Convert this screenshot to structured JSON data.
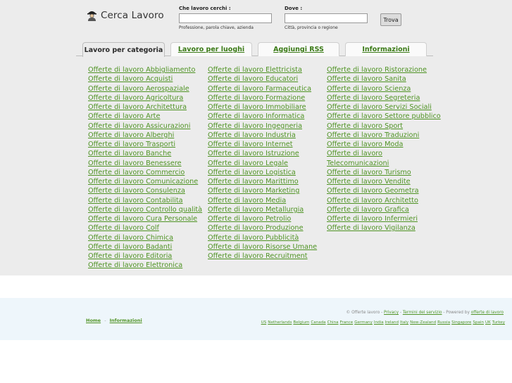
{
  "logo": {
    "text": "Cerca Lavoro"
  },
  "search": {
    "what_label": "Che lavoro cerchi :",
    "what_hint": "Professione, parola chiave, azienda",
    "what_value": "",
    "where_label": "Dove :",
    "where_hint": "Città, provincia o regione",
    "where_value": "",
    "button_label": "Trova"
  },
  "tabs": [
    {
      "label": "Lavoro per categoria",
      "active": true
    },
    {
      "label": "Lavoro per luoghi",
      "active": false
    },
    {
      "label": "Aggiungi RSS",
      "active": false
    },
    {
      "label": "Informazioni",
      "active": false
    }
  ],
  "categories": {
    "col1": [
      "Offerte di lavoro Abbigliamento",
      "Offerte di lavoro Acquisti",
      "Offerte di lavoro Aerospaziale",
      "Offerte di lavoro Agricoltura",
      "Offerte di lavoro Architettura",
      "Offerte di lavoro Arte",
      "Offerte di lavoro Assicurazioni",
      "Offerte di lavoro Alberghi",
      "Offerte di lavoro Trasporti",
      "Offerte di lavoro Banche",
      "Offerte di lavoro Benessere",
      "Offerte di lavoro Commercio",
      "Offerte di lavoro Comunicazione",
      "Offerte di lavoro Consulenza",
      "Offerte di lavoro Contabilita",
      "Offerte di lavoro Controllo qualità",
      "Offerte di lavoro Cura Personale",
      "Offerte di lavoro Colf",
      "Offerte di lavoro Chimica",
      "Offerte di lavoro Badanti",
      "Offerte di lavoro Editoria",
      "Offerte di lavoro Elettronica"
    ],
    "col2": [
      "Offerte di lavoro Elettricista",
      "Offerte di lavoro Educatori",
      "Offerte di lavoro Farmaceutica",
      "Offerte di lavoro Formazione",
      "Offerte di lavoro Immobiliare",
      "Offerte di lavoro Informatica",
      "Offerte di lavoro Ingegneria",
      "Offerte di lavoro Industria",
      "Offerte di lavoro Internet",
      "Offerte di lavoro Istruzione",
      "Offerte di lavoro Legale",
      "Offerte di lavoro Logistica",
      "Offerte di lavoro Marittimo",
      "Offerte di lavoro Marketing",
      "Offerte di lavoro Media",
      "Offerte di lavoro Metallurgia",
      "Offerte di lavoro Petrolio",
      "Offerte di lavoro Produzione",
      "Offerte di lavoro Pubblicità",
      "Offerte di lavoro Risorse Umane",
      "Offerte di lavoro Recruitment"
    ],
    "col3": [
      "Offerte di lavoro Ristorazione",
      "Offerte di lavoro Sanita",
      "Offerte di lavoro Scienza",
      "Offerte di lavoro Segreteria",
      "Offerte di lavoro Servizi Sociali",
      "Offerte di lavoro Settore pubblico",
      "Offerte di lavoro Sport",
      "Offerte di lavoro Traduzioni",
      "Offerte di lavoro Moda",
      "Offerte di lavoro Telecomunicazioni",
      "Offerte di lavoro Turismo",
      "Offerte di lavoro Vendite",
      "Offerte di lavoro Geometra",
      "Offerte di lavoro Architetto",
      "Offerte di lavoro Grafica",
      "Offerte di lavoro Infermieri",
      "Offerte di lavoro Vigilanza"
    ]
  },
  "footer": {
    "home": "Home",
    "sep": "-",
    "info": "Informazioni",
    "copyright": "© Offerte lavoro -",
    "privacy": "Privacy",
    "terms": "Termini del servizio",
    "powered": "- Powered by",
    "powered_link": "offerte di lavoro",
    "countries": [
      "US",
      "Netherlands",
      "Belgium",
      "Canada",
      "China",
      "France",
      "Germany",
      "India",
      "Ireland",
      "Italy",
      "New-Zealand",
      "Russia",
      "Singapore",
      "Spain",
      "UK",
      "Turkey"
    ]
  },
  "colors": {
    "link": "#4f9324",
    "top_bg": "#ececec",
    "footer_bg": "#eef6fb"
  }
}
